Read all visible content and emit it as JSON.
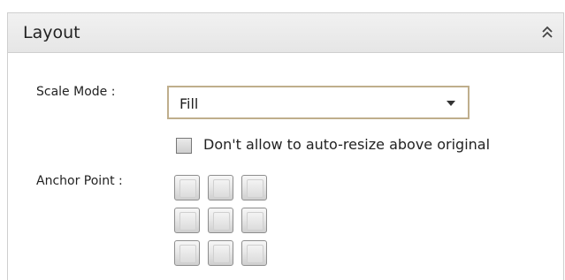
{
  "panel": {
    "title": "Layout",
    "collapse_icon": "double-chevron-up-icon"
  },
  "scale_mode": {
    "label": "Scale Mode :",
    "selected": "Fill",
    "dropdown_icon": "dropdown-arrow-icon"
  },
  "auto_resize": {
    "label": "Don't allow to auto-resize above original",
    "checked": false
  },
  "anchor_point": {
    "label": "Anchor Point :",
    "buttons": [
      "top-left",
      "top-center",
      "top-right",
      "middle-left",
      "middle-center",
      "middle-right",
      "bottom-left",
      "bottom-center",
      "bottom-right"
    ]
  },
  "colors": {
    "header_bg": "#e8e8e8",
    "border": "#cfcfcf",
    "select_border": "#bfae8c"
  }
}
